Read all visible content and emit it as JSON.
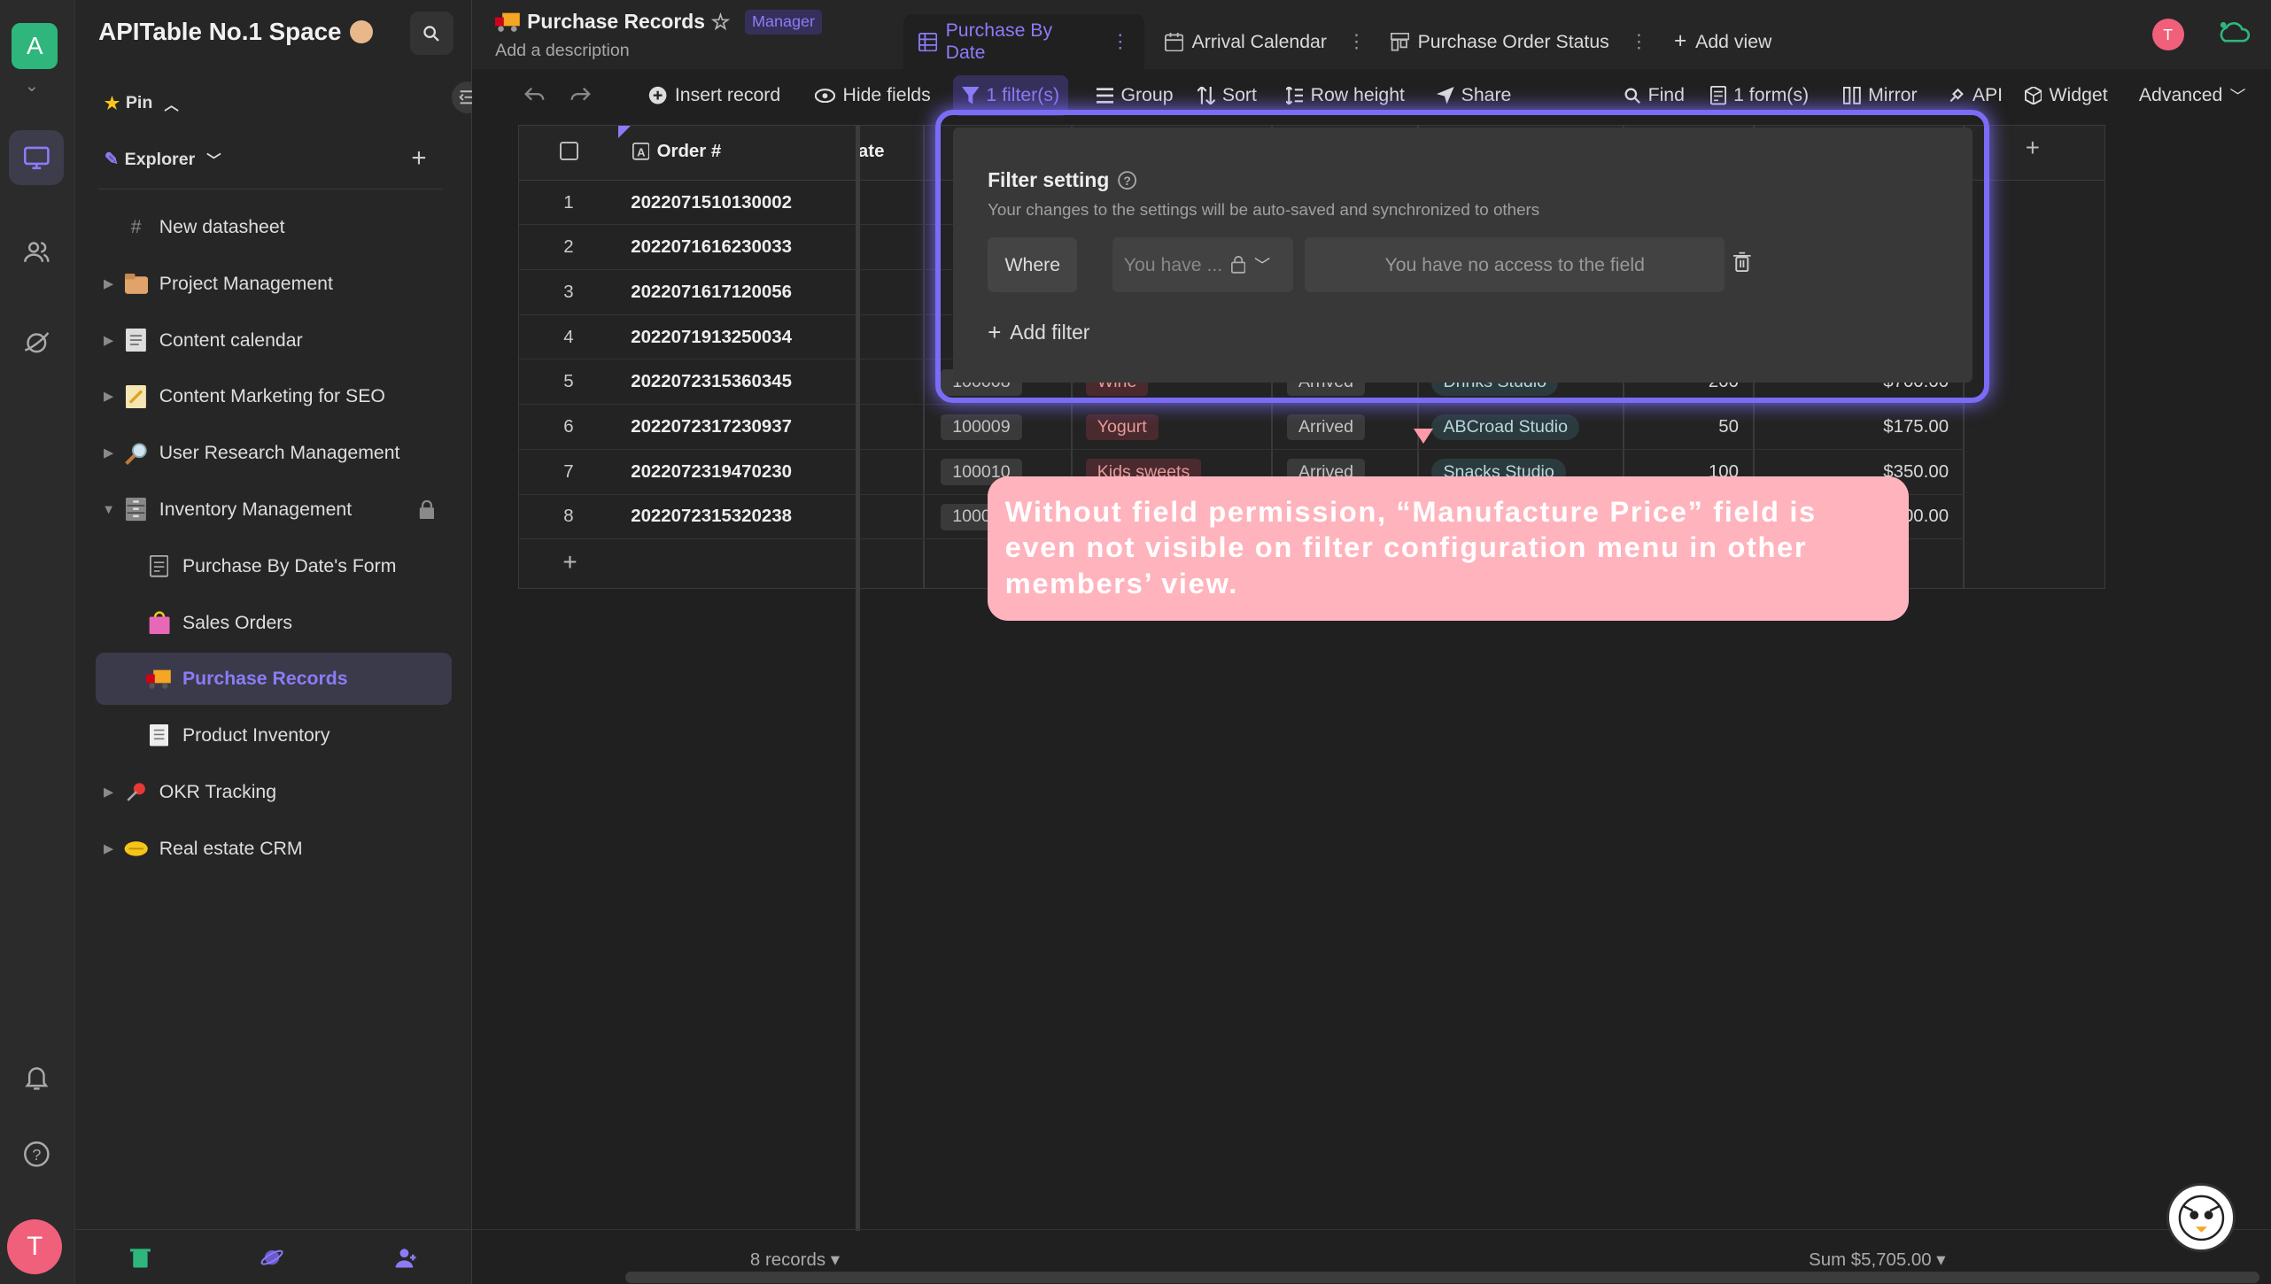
{
  "rail": {
    "space_letter": "A",
    "user_initial": "T"
  },
  "sidebar": {
    "space_name": "APITable No.1 Space",
    "pin_label": "Pin",
    "explorer_label": "Explorer",
    "items": [
      {
        "label": "New datasheet",
        "icon": "hash-icon"
      },
      {
        "label": "Project Management",
        "icon": "folder-icon"
      },
      {
        "label": "Content calendar",
        "icon": "calendar-doc-icon"
      },
      {
        "label": "Content Marketing for SEO",
        "icon": "memo-icon"
      },
      {
        "label": "User Research Management",
        "icon": "magnifier-icon"
      },
      {
        "label": "Inventory Management",
        "icon": "cabinet-icon"
      },
      {
        "label": "Purchase By Date's Form",
        "icon": "form-icon"
      },
      {
        "label": "Sales Orders",
        "icon": "shopping-bag-icon"
      },
      {
        "label": "Purchase Records",
        "icon": "truck-icon"
      },
      {
        "label": "Product Inventory",
        "icon": "doc-icon"
      },
      {
        "label": "OKR Tracking",
        "icon": "pushpin-icon"
      },
      {
        "label": "Real estate CRM",
        "icon": "handshake-icon"
      }
    ]
  },
  "header": {
    "title": "Purchase Records",
    "role": "Manager",
    "description": "Add a description",
    "tabs": [
      {
        "label": "Purchase By Date"
      },
      {
        "label": "Arrival Calendar"
      },
      {
        "label": "Purchase Order Status"
      },
      {
        "label": "Add view"
      }
    ],
    "avatar_initial": "T"
  },
  "toolbar": {
    "insert_record": "Insert record",
    "hide_fields": "Hide fields",
    "filters": "1 filter(s)",
    "group": "Group",
    "sort": "Sort",
    "row_height": "Row height",
    "share": "Share",
    "find": "Find",
    "forms": "1 form(s)",
    "mirror": "Mirror",
    "api": "API",
    "widget": "Widget",
    "advanced": "Advanced"
  },
  "grid": {
    "order_header": "Order #",
    "date_header_partial": "ate",
    "rows": [
      {
        "n": "1",
        "order": "2022071510130002"
      },
      {
        "n": "2",
        "order": "2022071616230033"
      },
      {
        "n": "3",
        "order": "2022071617120056"
      },
      {
        "n": "4",
        "order": "2022071913250034"
      },
      {
        "n": "5",
        "order": "2022072315360345",
        "id": "100008",
        "product": "Wine",
        "status": "Arrived",
        "supplier": "Drinks Studio",
        "qty": "200",
        "price": "$700.00"
      },
      {
        "n": "6",
        "order": "2022072317230937",
        "id": "100009",
        "product": "Yogurt",
        "status": "Arrived",
        "supplier": "ABCroad Studio",
        "qty": "50",
        "price": "$175.00"
      },
      {
        "n": "7",
        "order": "2022072319470230",
        "id": "100010",
        "product": "Kids sweets",
        "status": "Arrived",
        "supplier": "Snacks Studio",
        "qty": "100",
        "price": "$350.00"
      },
      {
        "n": "8",
        "order": "2022072315320238",
        "id": "1000",
        "price": "00.00"
      }
    ]
  },
  "filter": {
    "title": "Filter setting",
    "subtitle": "Your changes to the settings will be auto-saved and synchronized to others",
    "where": "Where",
    "field_placeholder": "You have ...",
    "value_text": "You have no access to the field",
    "add_filter": "Add filter"
  },
  "callout": {
    "text": "Without field permission, “Manufacture Price” field is even not visible on filter configuration menu in other members’ view."
  },
  "footer": {
    "records": "8 records ▾",
    "sum": "Sum $5,705.00 ▾"
  },
  "colors": {
    "accent": "#8b7cf6",
    "callout": "#ffb3bd",
    "space_badge": "#2eb67d",
    "avatar": "#f0607a"
  }
}
